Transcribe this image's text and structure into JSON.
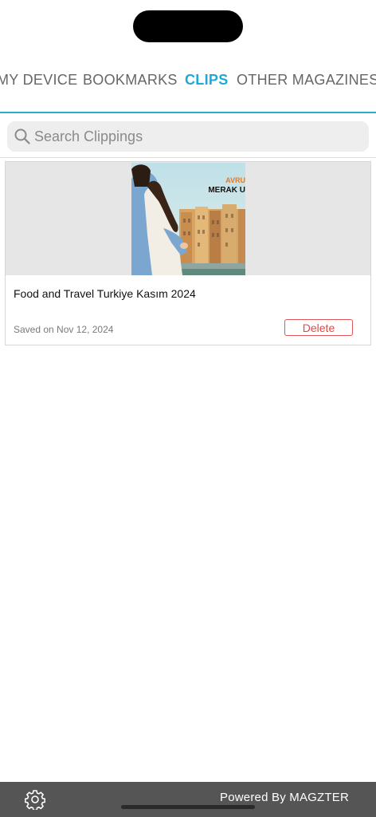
{
  "tabs": [
    {
      "label": "MY DEVICE",
      "active": false
    },
    {
      "label": "BOOKMARKS",
      "active": false
    },
    {
      "label": "CLIPS",
      "active": true
    },
    {
      "label": "OTHER MAGAZINES",
      "active": false
    }
  ],
  "search": {
    "placeholder": "Search Clippings",
    "value": ""
  },
  "clips": [
    {
      "title": "Food and Travel Turkiye Kasım 2024",
      "saved": "Saved on Nov 12, 2024",
      "delete_label": "Delete",
      "cover_overline": "AVRU",
      "cover_headline": "MERAK U"
    }
  ],
  "footer": {
    "powered_by": "Powered By MAGZTER"
  },
  "colors": {
    "accent": "#1fa8d8",
    "tab_underline": "#27b3c4",
    "delete": "#e04848",
    "footer_bg": "#555555"
  },
  "icons": [
    "search-icon",
    "gear-icon"
  ]
}
